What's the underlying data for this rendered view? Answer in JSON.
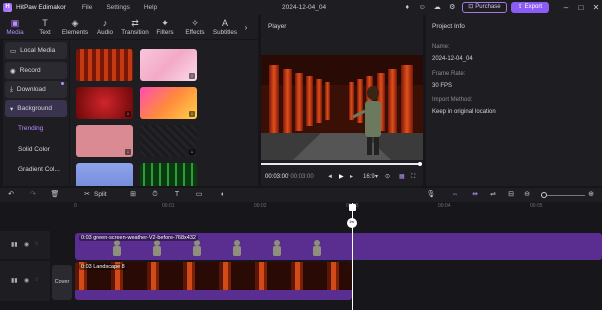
{
  "app": {
    "name": "HitPaw Edimakor",
    "logo_letter": "H"
  },
  "menu": [
    "File",
    "Settings",
    "Help"
  ],
  "document": {
    "title": "2024-12-04_04"
  },
  "header_actions": {
    "purchase": "Purchase",
    "export": "Export"
  },
  "tabs": [
    {
      "label": "Media",
      "icon": "folder-icon",
      "glyph": "▣",
      "active": true
    },
    {
      "label": "Text",
      "icon": "text-icon",
      "glyph": "T",
      "active": false
    },
    {
      "label": "Elements",
      "icon": "elements-icon",
      "glyph": "◈",
      "active": false
    },
    {
      "label": "Audio",
      "icon": "audio-icon",
      "glyph": "♪",
      "active": false
    },
    {
      "label": "Transition",
      "icon": "transition-icon",
      "glyph": "⇄",
      "active": false
    },
    {
      "label": "Filters",
      "icon": "filters-icon",
      "glyph": "✦",
      "active": false
    },
    {
      "label": "Effects",
      "icon": "effects-icon",
      "glyph": "✧",
      "active": false
    },
    {
      "label": "Subtitles",
      "icon": "subtitles-icon",
      "glyph": "A",
      "active": false
    }
  ],
  "sidebar": {
    "local_media": "Local Media",
    "record": "Record",
    "download": "Download",
    "background": "Background",
    "sub_items": [
      "Trending",
      "Solid Color",
      "Gradient Col..."
    ]
  },
  "player": {
    "title": "Player",
    "time_current": "00:03:00",
    "time_total": "/ 00:03:00",
    "aspect": "16:9"
  },
  "project_info": {
    "title": "Project Info",
    "fields": [
      {
        "label": "Name:",
        "value": "2024-12-04_04"
      },
      {
        "label": "Frame Rate:",
        "value": "30 FPS"
      },
      {
        "label": "Import Method:",
        "value": "Keep in original location"
      }
    ]
  },
  "timeline_toolbar": {
    "split": "Split"
  },
  "timeline": {
    "ruler": [
      "0",
      "00:01",
      "00:02",
      "00:03",
      "00:04",
      "00:05"
    ],
    "cover_label": "Cover",
    "clips": [
      {
        "label": "0:03  green-screen-weather-V2-before-768x432"
      },
      {
        "label": "0:03  Landscape 8"
      }
    ]
  },
  "colors": {
    "accent": "#8b5cf6",
    "active_tab": "#b98cff",
    "clip": "#5a2e91"
  }
}
